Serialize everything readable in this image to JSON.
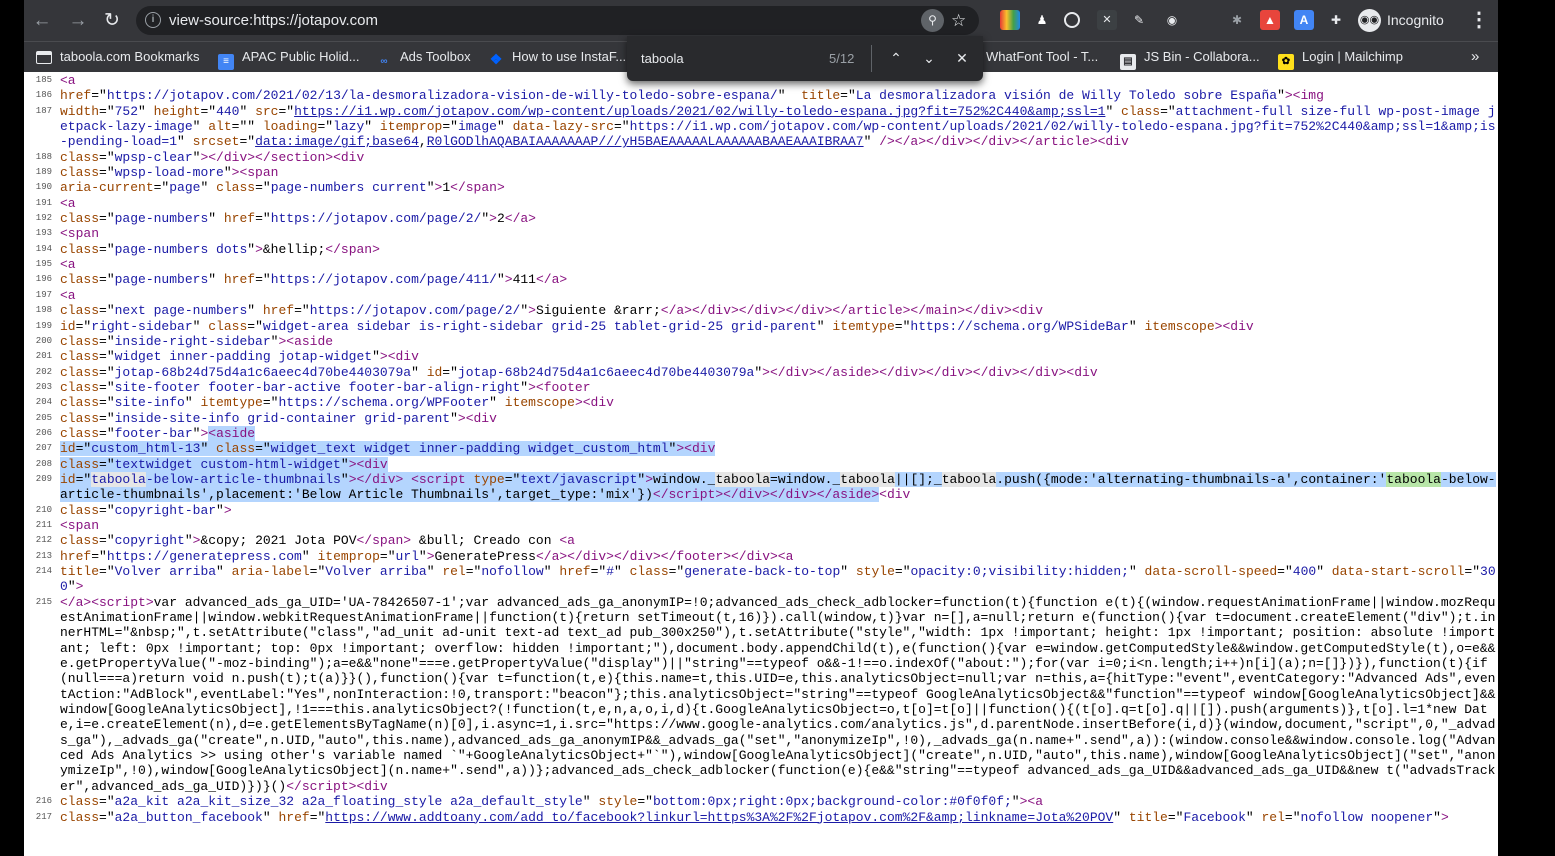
{
  "browser": {
    "url": "view-source:https://jotapov.com",
    "incognito_label": "Incognito",
    "extensions": [
      "colorzilla-icon",
      "wappalyzer-icon",
      "circle-icon",
      "x-icon",
      "pen-icon",
      "camera-icon",
      "bug-icon",
      "fire-icon",
      "translate-icon",
      "puzzle-icon"
    ]
  },
  "bookmarks": [
    {
      "label": "taboola.com Bookmarks",
      "icon": "folder-icon"
    },
    {
      "label": "APAC Public Holid...",
      "icon": "doc-icon"
    },
    {
      "label": "Ads Toolbox",
      "icon": "ads-icon"
    },
    {
      "label": "How to use InstaF...",
      "icon": "dropbox-icon"
    },
    {
      "label": "WhatFont Tool - T...",
      "icon": "whatfont-icon"
    },
    {
      "label": "JS Bin - Collabora...",
      "icon": "jsbin-icon"
    },
    {
      "label": "Login | Mailchimp",
      "icon": "mailchimp-icon"
    }
  ],
  "bookmarks_more": "»",
  "find": {
    "query": "taboola",
    "count": "5/12"
  },
  "lines": [
    {
      "n": "185",
      "h": "<span class=\"t\">&lt;a</span>"
    },
    {
      "n": "186",
      "h": "<span class=\"a\">href</span>=\"<span class=\"v\">https://jotapov.com/2021/02/13/la-desmoralizadora-vision-de-willy-toledo-sobre-espana/</span>\"  <span class=\"a\">title</span>=\"<span class=\"v\">La desmoralizadora visión de Willy Toledo sobre España</span>\"<span class=\"t\">&gt;&lt;img</span>"
    },
    {
      "n": "187",
      "h": "<span class=\"a\">width</span>=\"<span class=\"v\">752</span>\" <span class=\"a\">height</span>=\"<span class=\"v\">440</span>\" <span class=\"a\">src</span>=\"<span class=\"k\">https://i1.wp.com/jotapov.com/wp-content/uploads/2021/02/willy-toledo-espana.jpg?fit=752%2C440&amp;amp;ssl=1</span>\" <span class=\"a\">class</span>=\"<span class=\"v\">attachment-full size-full wp-post-image jetpack-lazy-image</span>\" <span class=\"a\">alt</span>=\"\" <span class=\"a\">loading</span>=\"<span class=\"v\">lazy</span>\" <span class=\"a\">itemprop</span>=\"<span class=\"v\">image</span>\" <span class=\"a\">data-lazy-src</span>=\"<span class=\"v\">https://i1.wp.com/jotapov.com/wp-content/uploads/2021/02/willy-toledo-espana.jpg?fit=752%2C440&amp;amp;ssl=1&amp;amp;is-pending-load=1</span>\" <span class=\"a\">srcset</span>=\"<span class=\"k\">data:image/gif;base64</span>,<span class=\"k\">R0lGODlhAQABAIAAAAAAAP///yH5BAEAAAAALAAAAAABAAEAAAIBRAA7</span>\" <span class=\"t\">/&gt;&lt;/a&gt;&lt;/div&gt;&lt;/div&gt;&lt;/article&gt;&lt;div</span>"
    },
    {
      "n": "188",
      "h": "<span class=\"a\">class</span>=\"<span class=\"v\">wpsp-clear</span>\"<span class=\"t\">&gt;&lt;/div&gt;&lt;/section&gt;&lt;div</span>"
    },
    {
      "n": "189",
      "h": "<span class=\"a\">class</span>=\"<span class=\"v\">wpsp-load-more</span>\"<span class=\"t\">&gt;&lt;span</span>"
    },
    {
      "n": "190",
      "h": "<span class=\"a\">aria-current</span>=\"<span class=\"v\">page</span>\" <span class=\"a\">class</span>=\"<span class=\"v\">page-numbers current</span>\"<span class=\"t\">&gt;</span>1<span class=\"t\">&lt;/span&gt;</span>"
    },
    {
      "n": "191",
      "h": "<span class=\"t\">&lt;a</span>"
    },
    {
      "n": "192",
      "h": "<span class=\"a\">class</span>=\"<span class=\"v\">page-numbers</span>\" <span class=\"a\">href</span>=\"<span class=\"v\">https://jotapov.com/page/2/</span>\"<span class=\"t\">&gt;</span>2<span class=\"t\">&lt;/a&gt;</span>"
    },
    {
      "n": "193",
      "h": "<span class=\"t\">&lt;span</span>"
    },
    {
      "n": "194",
      "h": "<span class=\"a\">class</span>=\"<span class=\"v\">page-numbers dots</span>\"<span class=\"t\">&gt;</span>&amp;hellip;<span class=\"t\">&lt;/span&gt;</span>"
    },
    {
      "n": "195",
      "h": "<span class=\"t\">&lt;a</span>"
    },
    {
      "n": "196",
      "h": "<span class=\"a\">class</span>=\"<span class=\"v\">page-numbers</span>\" <span class=\"a\">href</span>=\"<span class=\"v\">https://jotapov.com/page/411/</span>\"<span class=\"t\">&gt;</span>411<span class=\"t\">&lt;/a&gt;</span>"
    },
    {
      "n": "197",
      "h": "<span class=\"t\">&lt;a</span>"
    },
    {
      "n": "198",
      "h": "<span class=\"a\">class</span>=\"<span class=\"v\">next page-numbers</span>\" <span class=\"a\">href</span>=\"<span class=\"v\">https://jotapov.com/page/2/</span>\"<span class=\"t\">&gt;</span>Siguiente &amp;rarr;<span class=\"t\">&lt;/a&gt;&lt;/div&gt;&lt;/div&gt;&lt;/div&gt;&lt;/article&gt;&lt;/main&gt;&lt;/div&gt;&lt;div</span>"
    },
    {
      "n": "199",
      "h": "<span class=\"a\">id</span>=\"<span class=\"v\">right-sidebar</span>\" <span class=\"a\">class</span>=\"<span class=\"v\">widget-area sidebar is-right-sidebar grid-25 tablet-grid-25 grid-parent</span>\" <span class=\"a\">itemtype</span>=\"<span class=\"v\">https://schema.org/WPSideBar</span>\" <span class=\"a\">itemscope</span><span class=\"t\">&gt;&lt;div</span>"
    },
    {
      "n": "200",
      "h": "<span class=\"a\">class</span>=\"<span class=\"v\">inside-right-sidebar</span>\"<span class=\"t\">&gt;&lt;aside</span>"
    },
    {
      "n": "201",
      "h": "<span class=\"a\">class</span>=\"<span class=\"v\">widget inner-padding jotap-widget</span>\"<span class=\"t\">&gt;&lt;div</span>"
    },
    {
      "n": "202",
      "h": "<span class=\"a\">class</span>=\"<span class=\"v\">jotap-68b24d75d4a1c6aeec4d70be4403079a</span>\" <span class=\"a\">id</span>=\"<span class=\"v\">jotap-68b24d75d4a1c6aeec4d70be4403079a</span>\"<span class=\"t\">&gt;&lt;/div&gt;&lt;/aside&gt;&lt;/div&gt;&lt;/div&gt;&lt;/div&gt;&lt;/div&gt;&lt;div</span>"
    },
    {
      "n": "203",
      "h": "<span class=\"a\">class</span>=\"<span class=\"v\">site-footer footer-bar-active footer-bar-align-right</span>\"<span class=\"t\">&gt;&lt;footer</span>"
    },
    {
      "n": "204",
      "h": "<span class=\"a\">class</span>=\"<span class=\"v\">site-info</span>\" <span class=\"a\">itemtype</span>=\"<span class=\"v\">https://schema.org/WPFooter</span>\" <span class=\"a\">itemscope</span><span class=\"t\">&gt;&lt;div</span>"
    },
    {
      "n": "205",
      "h": "<span class=\"a\">class</span>=\"<span class=\"v\">inside-site-info grid-container grid-parent</span>\"<span class=\"t\">&gt;&lt;div</span>"
    },
    {
      "n": "206",
      "h": "<span class=\"a\">class</span>=\"<span class=\"v\">footer-bar</span>\"<span class=\"t\">&gt;</span><span class=\"sel\"><span class=\"t\">&lt;aside</span></span>"
    },
    {
      "n": "207",
      "h": "<span class=\"sel\"><span class=\"a\">id</span>=\"<span class=\"v\">custom_html-13</span>\" <span class=\"a\">class</span>=\"<span class=\"v\">widget_text widget inner-padding widget_custom_html</span>\"<span class=\"t\">&gt;&lt;div</span></span>"
    },
    {
      "n": "208",
      "h": "<span class=\"sel\"><span class=\"a\">class</span>=\"<span class=\"v\">textwidget custom-html-widget</span>\"<span class=\"t\">&gt;&lt;div</span></span>"
    },
    {
      "n": "209",
      "h": "<span class=\"sel\"><span class=\"a\">id</span>=\"<span class=\"v\"><span class=\"hit\">taboola</span>-below-article-thumbnails</span>\"<span class=\"t\">&gt;&lt;/div&gt;</span> <span class=\"t\">&lt;script</span> <span class=\"a\">type</span>=\"<span class=\"v\">text/javascript</span>\"<span class=\"t\">&gt;</span>window._<span class=\"hit\">taboola</span>=window._<span class=\"hit\">taboola</span>||[];_<span class=\"hit\">taboola</span>.push({mode:'alternating-thumbnails-a',container:'<span class=\"cur\">taboola</span>-below-article-thumbnails',placement:'Below Article Thumbnails',target_type:'mix'})<span class=\"t\">&lt;/script&gt;&lt;/div&gt;&lt;/div&gt;&lt;/aside&gt;</span></span><span class=\"t\">&lt;div</span>"
    },
    {
      "n": "210",
      "h": "<span class=\"a\">class</span>=\"<span class=\"v\">copyright-bar</span>\"<span class=\"t\">&gt;</span>"
    },
    {
      "n": "211",
      "h": "<span class=\"t\">&lt;span</span>"
    },
    {
      "n": "212",
      "h": "<span class=\"a\">class</span>=\"<span class=\"v\">copyright</span>\"<span class=\"t\">&gt;</span>&amp;copy; 2021 Jota POV<span class=\"t\">&lt;/span&gt;</span> &amp;bull; Creado con <span class=\"t\">&lt;a</span>"
    },
    {
      "n": "213",
      "h": "<span class=\"a\">href</span>=\"<span class=\"v\">https://generatepress.com</span>\" <span class=\"a\">itemprop</span>=\"<span class=\"v\">url</span>\"<span class=\"t\">&gt;</span>GeneratePress<span class=\"t\">&lt;/a&gt;&lt;/div&gt;&lt;/div&gt;&lt;/footer&gt;&lt;/div&gt;&lt;a</span>"
    },
    {
      "n": "214",
      "h": "<span class=\"a\">title</span>=\"<span class=\"v\">Volver arriba</span>\" <span class=\"a\">aria-label</span>=\"<span class=\"v\">Volver arriba</span>\" <span class=\"a\">rel</span>=\"<span class=\"v\">nofollow</span>\" <span class=\"a\">href</span>=\"<span class=\"v\">#</span>\" <span class=\"a\">class</span>=\"<span class=\"v\">generate-back-to-top</span>\" <span class=\"a\">style</span>=\"<span class=\"v\">opacity:0;visibility:hidden;</span>\" <span class=\"a\">data-scroll-speed</span>=\"<span class=\"v\">400</span>\" <span class=\"a\">data-start-scroll</span>=\"<span class=\"v\">300</span>\"<span class=\"t\">&gt;</span>"
    },
    {
      "n": "215",
      "h": "<span class=\"t\">&lt;/a&gt;&lt;script&gt;</span>var advanced_ads_ga_UID='UA-78426507-1';var advanced_ads_ga_anonymIP=!0;advanced_ads_check_adblocker=function(t){function e(t){(window.requestAnimationFrame||window.mozRequestAnimationFrame||window.webkitRequestAnimationFrame||function(t){return setTimeout(t,16)}).call(window,t)}var n=[],a=null;return e(function(){var t=document.createElement(\"div\");t.innerHTML=\"&amp;nbsp;\",t.setAttribute(\"class\",\"ad_unit ad-unit text-ad text_ad pub_300x250\"),t.setAttribute(\"style\",\"width: 1px !important; height: 1px !important; position: absolute !important; left: 0px !important; top: 0px !important; overflow: hidden !important;\"),document.body.appendChild(t),e(function(){var e=window.getComputedStyle&amp;&amp;window.getComputedStyle(t),o=e&amp;&amp;e.getPropertyValue(\"-moz-binding\");a=e&amp;&amp;\"none\"===e.getPropertyValue(\"display\")||\"string\"==typeof o&amp;&amp;-1!==o.indexOf(\"about:\");for(var i=0;i&lt;n.length;i++)n[i](a);n=[]})}),function(t){if(null===a)return void n.push(t);t(a)}}(),function(){var t=function(t,e){this.name=t,this.UID=e,this.analyticsObject=null;var n=this,a={hitType:\"event\",eventCategory:\"Advanced Ads\",eventAction:\"AdBlock\",eventLabel:\"Yes\",nonInteraction:!0,transport:\"beacon\"};this.analyticsObject=\"string\"==typeof GoogleAnalyticsObject&amp;&amp;\"function\"==typeof window[GoogleAnalyticsObject]&amp;&amp;window[GoogleAnalyticsObject],!1===this.analyticsObject?(!function(t,e,n,a,o,i,d){t.GoogleAnalyticsObject=o,t[o]=t[o]||function(){(t[o].q=t[o].q||[]).push(arguments)},t[o].l=1*new Date,i=e.createElement(n),d=e.getElementsByTagName(n)[0],i.async=1,i.src=\"https://www.google-analytics.com/analytics.js\",d.parentNode.insertBefore(i,d)}(window,document,\"script\",0,\"_advads_ga\"),_advads_ga(\"create\",n.UID,\"auto\",this.name),advanced_ads_ga_anonymIP&amp;&amp;_advads_ga(\"set\",\"anonymizeIp\",!0),_advads_ga(n.name+\".send\",a)):(window.console&amp;&amp;window.console.log(\"Advanced Ads Analytics &gt;&gt; using other's variable named `\"+GoogleAnalyticsObject+\"`\"),window[GoogleAnalyticsObject](\"create\",n.UID,\"auto\",this.name),window[GoogleAnalyticsObject](\"set\",\"anonymizeIp\",!0),window[GoogleAnalyticsObject](n.name+\".send\",a))};advanced_ads_check_adblocker(function(e){e&amp;&amp;\"string\"==typeof advanced_ads_ga_UID&amp;&amp;advanced_ads_ga_UID&amp;&amp;new t(\"advadsTracker\",advanced_ads_ga_UID)})}()<span class=\"t\">&lt;/script&gt;&lt;div</span>"
    },
    {
      "n": "216",
      "h": "<span class=\"a\">class</span>=\"<span class=\"v\">a2a_kit a2a_kit_size_32 a2a_floating_style a2a_default_style</span>\" <span class=\"a\">style</span>=\"<span class=\"v\">bottom:0px;right:0px;background-color:#0f0f0f;</span>\"<span class=\"t\">&gt;&lt;a</span>"
    },
    {
      "n": "217",
      "h": "<span class=\"a\">class</span>=\"<span class=\"v\">a2a_button_facebook</span>\" <span class=\"a\">href</span>=\"<span class=\"k\">https://www.addtoany.com/add_to/facebook?linkurl=https%3A%2F%2Fjotapov.com%2F&amp;amp;linkname=Jota%20POV</span>\" <span class=\"a\">title</span>=\"<span class=\"v\">Facebook</span>\" <span class=\"a\">rel</span>=\"<span class=\"v\">nofollow noopener</span>\"<span class=\"t\">&gt;</span>"
    }
  ]
}
